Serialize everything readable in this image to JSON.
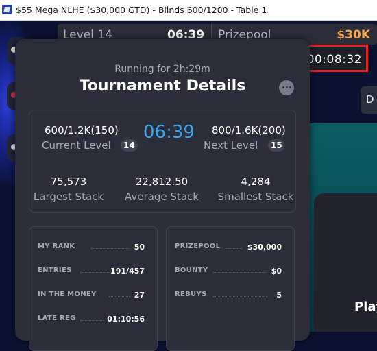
{
  "window": {
    "title": "$55 Mega NLHE ($30,000 GTD) - Blinds 600/1200 - Table 1"
  },
  "background": {
    "level_label": "Level 14",
    "level_time": "06:39",
    "prizepool_label": "Prizepool",
    "prizepool_value": "$30K",
    "timer": "00:08:32",
    "right_tab": "D",
    "play_label": "Play"
  },
  "modal": {
    "running": "Running for 2h:29m",
    "title": "Tournament Details",
    "current_level": {
      "blinds": "600/1.2K(150)",
      "label": "Current Level",
      "number": "14"
    },
    "clock": "06:39",
    "next_level": {
      "blinds": "800/1.6K(200)",
      "label": "Next Level",
      "number": "15"
    },
    "stacks": [
      {
        "value": "75,573",
        "label": "Largest Stack"
      },
      {
        "value": "22,812.50",
        "label": "Average Stack"
      },
      {
        "value": "4,284",
        "label": "Smallest Stack"
      }
    ],
    "left_stats": [
      {
        "key": "MY RANK",
        "value": "50"
      },
      {
        "key": "ENTRIES",
        "value": "191/457"
      },
      {
        "key": "IN THE MONEY",
        "value": "27"
      },
      {
        "key": "LATE REG",
        "value": "01:10:56"
      }
    ],
    "right_stats": [
      {
        "key": "PRIZEPOOL",
        "value": "$30,000"
      },
      {
        "key": "BOUNTY",
        "value": "$0"
      },
      {
        "key": "REBUYS",
        "value": "5"
      }
    ]
  },
  "colors": {
    "accent_clock": "#3aa3ef",
    "prizepool": "#f6a44a",
    "highlight_box": "#e32222"
  }
}
